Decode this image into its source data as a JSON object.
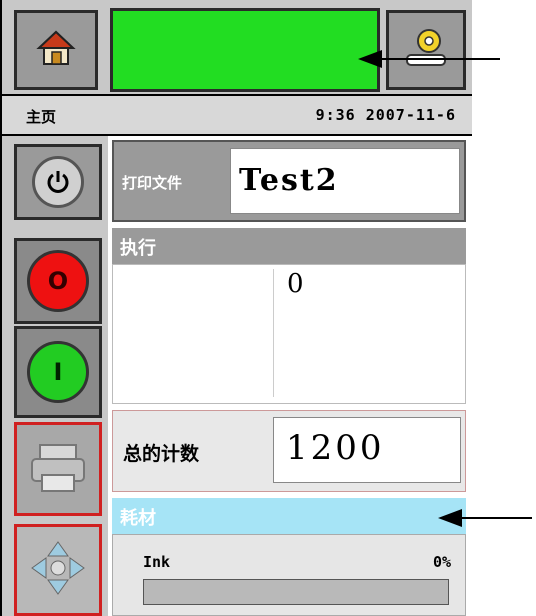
{
  "header": {
    "status_text": "",
    "home_icon": "home-icon",
    "settings_icon": "settings-gear-icon"
  },
  "info": {
    "page_title": "主页",
    "clock": "9:36 2007-11-6"
  },
  "sidebar": {
    "power_icon": "power-icon",
    "stop_label": "O",
    "start_label": "I",
    "print_icon": "printer-icon",
    "nav_icon": "navigation-arrows-icon"
  },
  "file": {
    "label": "打印文件",
    "value": "Test2"
  },
  "exec": {
    "title": "执行",
    "row1_label": "",
    "row1_value": "0",
    "row2_label": "",
    "row2_value": ""
  },
  "total": {
    "label": "总的计数",
    "value": "1200"
  },
  "consumables": {
    "title": "耗材",
    "ink_label": "Ink",
    "ink_percent_text": "0%",
    "ink_level": 0
  },
  "colors": {
    "status_green": "#22dd22",
    "stop_red": "#ee1111",
    "start_green": "#22cc22",
    "consumables_blue": "#a6e4f6"
  }
}
